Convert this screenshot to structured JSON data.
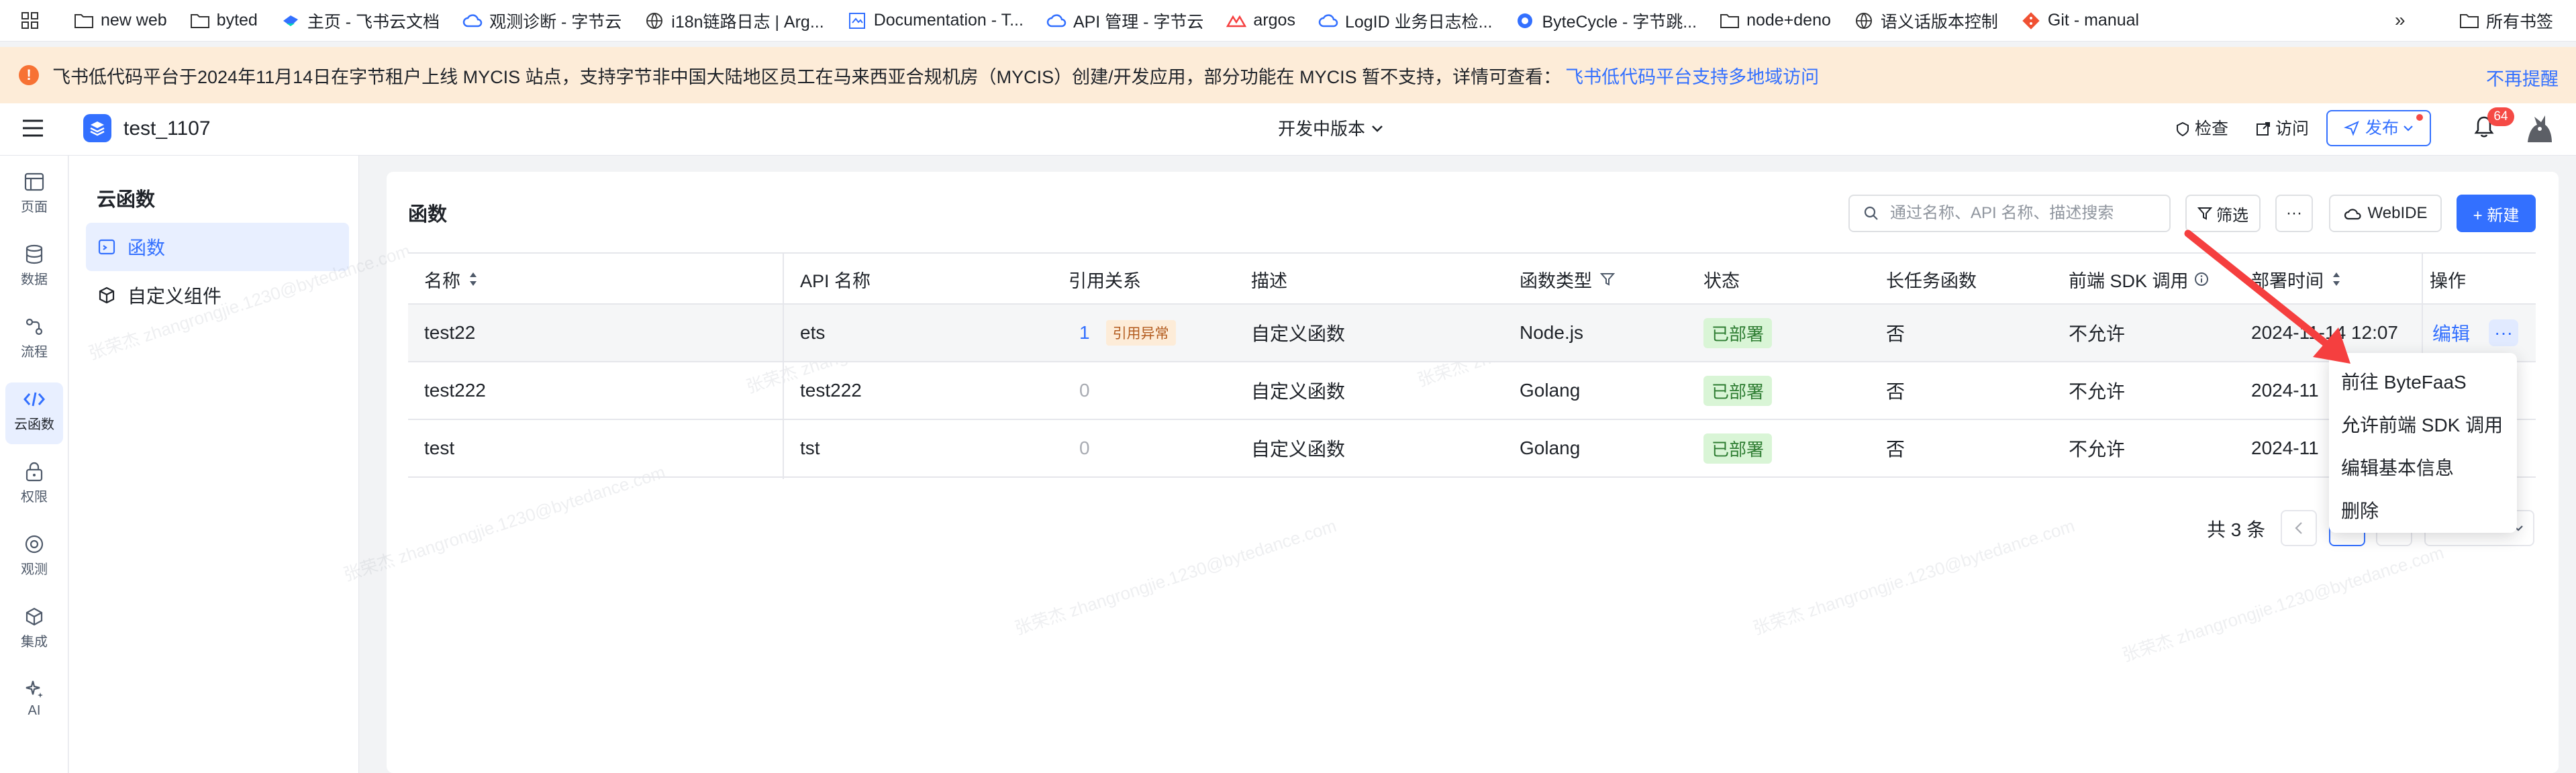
{
  "bookmarks": {
    "items": [
      {
        "label": "new web",
        "icon": "folder-icon"
      },
      {
        "label": "byted",
        "icon": "folder-icon"
      },
      {
        "label": "主页 - 飞书云文档",
        "icon": "feishu-icon"
      },
      {
        "label": "观测诊断 - 字节云",
        "icon": "cloud-icon"
      },
      {
        "label": "i18n链路日志 | Arg...",
        "icon": "globe-icon"
      },
      {
        "label": "Documentation - T...",
        "icon": "doc-icon"
      },
      {
        "label": "API 管理 - 字节云",
        "icon": "cloud-icon"
      },
      {
        "label": "argos",
        "icon": "argos-icon"
      },
      {
        "label": "LogID 业务日志检...",
        "icon": "cloud-icon"
      },
      {
        "label": "ByteCycle - 字节跳...",
        "icon": "bytecycle-icon"
      },
      {
        "label": "node+deno",
        "icon": "folder-icon"
      },
      {
        "label": "语义话版本控制",
        "icon": "globe-icon"
      },
      {
        "label": "Git - manual",
        "icon": "git-icon"
      }
    ],
    "more_label": "»",
    "all_label": "所有书签"
  },
  "notice": {
    "text": "飞书低代码平台于2024年11月14日在字节租户上线 MYCIS 站点，支持字节非中国大陆地区员工在马来西亚合规机房（MYCIS）创建/开发应用，部分功能在 MYCIS 暂不支持，详情可查看：",
    "link": "飞书低代码平台支持多地域访问",
    "close": "不再提醒"
  },
  "header": {
    "app_name": "test_1107",
    "version": "开发中版本",
    "check": "检查",
    "visit": "访问",
    "publish": "发布",
    "bell_count": "64"
  },
  "rail": {
    "items": [
      {
        "label": "页面",
        "icon": "page-icon"
      },
      {
        "label": "数据",
        "icon": "database-icon"
      },
      {
        "label": "流程",
        "icon": "flow-icon"
      },
      {
        "label": "云函数",
        "icon": "code-icon",
        "active": true
      },
      {
        "label": "权限",
        "icon": "lock-icon"
      },
      {
        "label": "观测",
        "icon": "monitor-icon"
      },
      {
        "label": "集成",
        "icon": "cube-icon"
      },
      {
        "label": "AI",
        "icon": "sparkle-icon"
      }
    ]
  },
  "subnav": {
    "title": "云函数",
    "items": [
      {
        "label": "函数",
        "active": true
      },
      {
        "label": "自定义组件",
        "active": false
      }
    ]
  },
  "main": {
    "title": "函数",
    "search_placeholder": "通过名称、API 名称、描述搜索",
    "filter": "筛选",
    "more": "···",
    "webide": "WebIDE",
    "new": "+ 新建"
  },
  "table": {
    "columns": [
      "名称",
      "API 名称",
      "引用关系",
      "描述",
      "函数类型",
      "状态",
      "长任务函数",
      "前端 SDK 调用",
      "部署时间",
      "操作"
    ],
    "rows": [
      {
        "name": "test22",
        "api": "ets",
        "ref": "1",
        "ref_tag": "引用异常",
        "desc": "自定义函数",
        "type": "Node.js",
        "status": "已部署",
        "long_task": "否",
        "sdk": "不允许",
        "deploy_time": "2024-11-14 12:07"
      },
      {
        "name": "test222",
        "api": "test222",
        "ref": "0",
        "ref_tag": "",
        "desc": "自定义函数",
        "type": "Golang",
        "status": "已部署",
        "long_task": "否",
        "sdk": "不允许",
        "deploy_time": "2024-11"
      },
      {
        "name": "test",
        "api": "tst",
        "ref": "0",
        "ref_tag": "",
        "desc": "自定义函数",
        "type": "Golang",
        "status": "已部署",
        "long_task": "否",
        "sdk": "不允许",
        "deploy_time": "2024-11"
      }
    ],
    "edit_label": "编辑",
    "more_label": "···"
  },
  "pagination": {
    "total": "共 3 条"
  },
  "dropdown": {
    "items": [
      "前往 ByteFaaS",
      "允许前端 SDK 调用",
      "编辑基本信息",
      "删除"
    ]
  },
  "watermark": "张荣杰 zhangrongjie.1230@bytedance.com",
  "colors": {
    "primary": "#3370ff",
    "warning": "#f77234",
    "success_bg": "#d9f5d6",
    "arrow": "#f53f3f"
  }
}
